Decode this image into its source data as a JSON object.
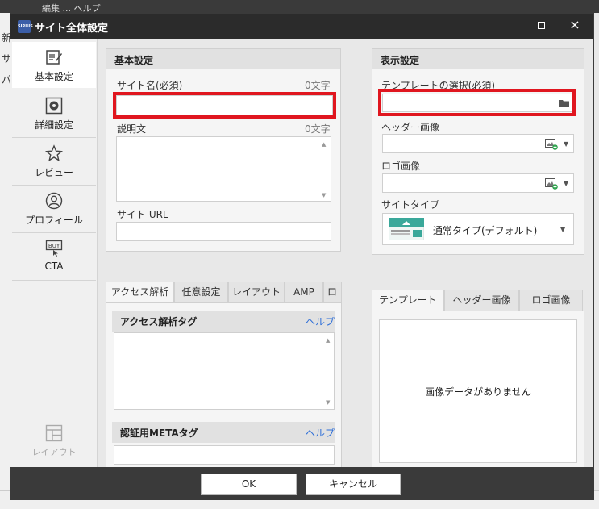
{
  "background": {
    "menu_text": "編集  ...  ヘルプ",
    "left_glyphs": [
      "新",
      "サ",
      "パ"
    ]
  },
  "dialog": {
    "title": "サイト全体設定",
    "app_icon_text": "SIRIUS",
    "maximize_icon": "maximize-icon",
    "close_icon": "×"
  },
  "sidebar": {
    "items": [
      {
        "label": "基本設定",
        "icon": "edit-icon"
      },
      {
        "label": "詳細設定",
        "icon": "gear-icon"
      },
      {
        "label": "レビュー",
        "icon": "star-icon"
      },
      {
        "label": "プロフィール",
        "icon": "user-icon"
      },
      {
        "label": "CTA",
        "icon": "buy-icon",
        "icon_text": "BUY"
      },
      {
        "label": "レイアウト",
        "icon": "layout-icon"
      }
    ]
  },
  "basic": {
    "title": "基本設定",
    "site_name_label": "サイト名(必須)",
    "site_name_count": "0文字",
    "site_name_value": "",
    "desc_label": "説明文",
    "desc_count": "0文字",
    "site_url_label": "サイト URL",
    "site_url_value": ""
  },
  "display": {
    "title": "表示設定",
    "template_label": "テンプレートの選択(必須)",
    "header_image_label": "ヘッダー画像",
    "logo_image_label": "ロゴ画像",
    "site_type_label": "サイトタイプ",
    "site_type_value": "通常タイプ(デフォルト)"
  },
  "tabs_left": {
    "tabs": [
      "アクセス解析",
      "任意設定",
      "レイアウト",
      "AMP",
      "ロゴ"
    ],
    "access_tag_title": "アクセス解析タグ",
    "access_help": "ヘルプ",
    "meta_title": "認証用METAタグ",
    "meta_help": "ヘルプ"
  },
  "tabs_right": {
    "tabs": [
      "テンプレート",
      "ヘッダー画像",
      "ロゴ画像"
    ],
    "no_image_text": "画像データがありません"
  },
  "footer": {
    "ok_label": "OK",
    "cancel_label": "キャンセル"
  },
  "colors": {
    "highlight_red": "#e0161f",
    "help_link": "#2f6fd8",
    "titlebar": "#2b2b2b"
  }
}
